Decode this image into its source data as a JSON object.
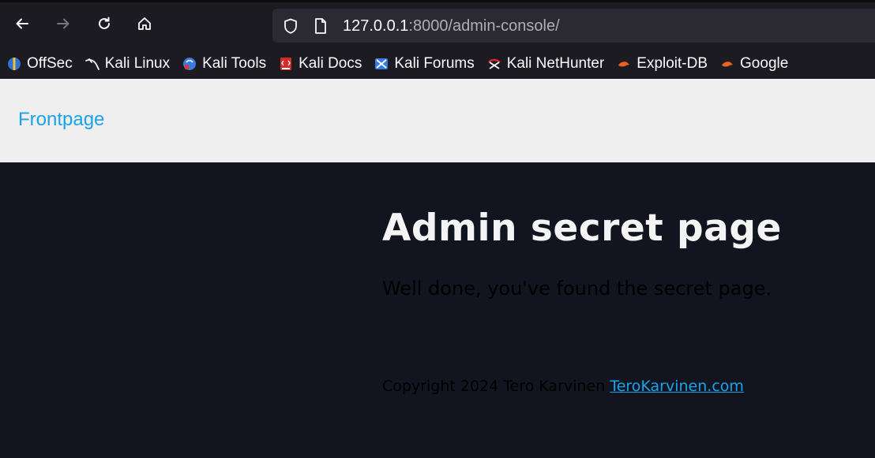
{
  "browser": {
    "url_host": "127.0.0.1",
    "url_rest": ":8000/admin-console/",
    "bookmarks": [
      {
        "label": "OffSec",
        "icon": "offsec-icon"
      },
      {
        "label": "Kali Linux",
        "icon": "kali-dragon-icon"
      },
      {
        "label": "Kali Tools",
        "icon": "kali-tools-icon"
      },
      {
        "label": "Kali Docs",
        "icon": "kali-docs-icon"
      },
      {
        "label": "Kali Forums",
        "icon": "kali-forums-icon"
      },
      {
        "label": "Kali NetHunter",
        "icon": "kali-nethunter-icon"
      },
      {
        "label": "Exploit-DB",
        "icon": "exploit-db-icon"
      },
      {
        "label": "Google",
        "icon": "google-hacking-db-icon"
      }
    ]
  },
  "header": {
    "frontpage_link": "Frontpage"
  },
  "main": {
    "title": "Admin secret page",
    "lead": "Well done, you've found the secret page.",
    "footer_text": "Copyright 2024 Tero Karvinen ",
    "footer_link": "TeroKarvinen.com"
  },
  "colors": {
    "link": "#1aa3e8",
    "page_background": "#12151f",
    "header_background": "#efefef",
    "browser_chrome": "#1c1b22"
  }
}
